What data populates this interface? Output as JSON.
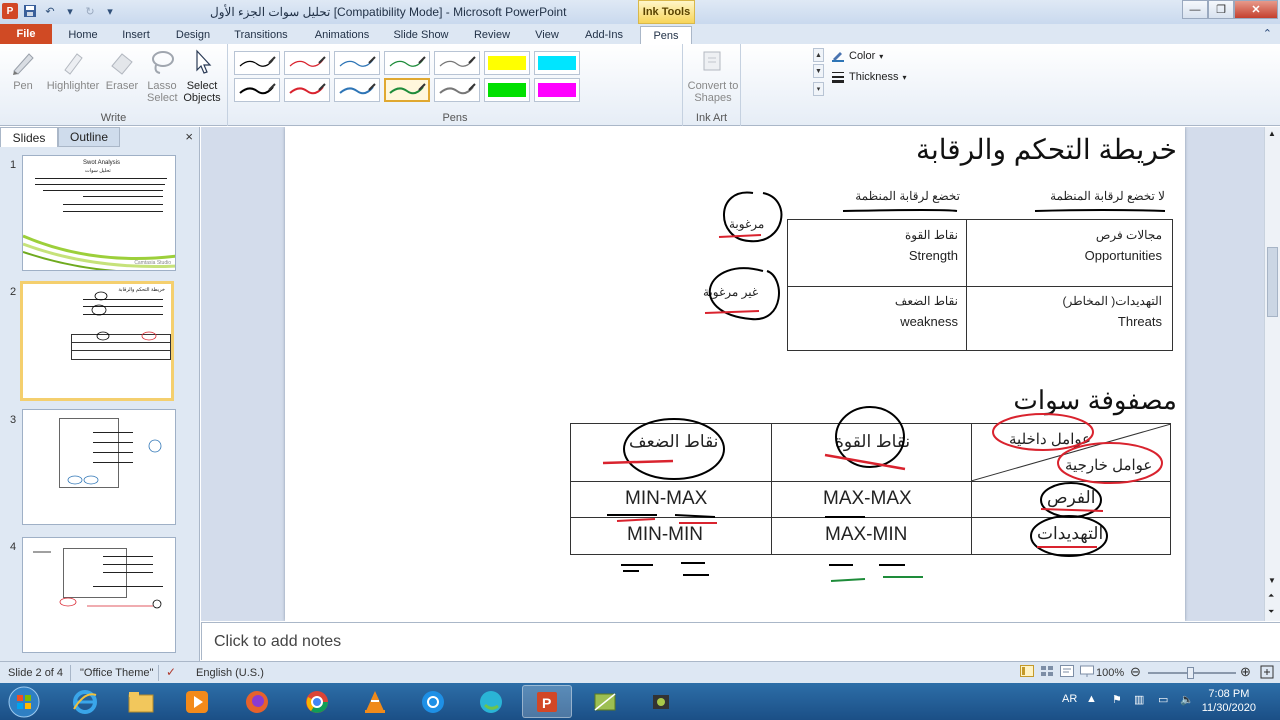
{
  "window": {
    "title": "تحليل سوات الجزء الأول [Compatibility Mode]  -  Microsoft PowerPoint",
    "context_tab_group": "Ink Tools",
    "app_letter": "P"
  },
  "ribbon_tabs": [
    "File",
    "Home",
    "Insert",
    "Design",
    "Transitions",
    "Animations",
    "Slide Show",
    "Review",
    "View",
    "Add-Ins",
    "Pens"
  ],
  "ribbon": {
    "write": {
      "label": "Write",
      "tools": [
        {
          "label": "Pen",
          "icon": "pen-icon"
        },
        {
          "label": "Highlighter",
          "icon": "highlighter-icon"
        },
        {
          "label": "Eraser",
          "icon": "eraser-icon"
        },
        {
          "label": "Lasso Select",
          "icon": "lasso-icon"
        },
        {
          "label": "Select Objects",
          "icon": "pointer-icon"
        }
      ]
    },
    "pens": {
      "label": "Pens",
      "swatches": [
        "#000000",
        "#d9232e",
        "#2e75b6",
        "#1e8c3a",
        "#777777",
        "#ffff00",
        "#00e5ff",
        "#000000",
        "#d9232e",
        "#2e75b6",
        "#1e8c3a",
        "#777777",
        "#00e000",
        "#ff00ff"
      ],
      "color_label": "Color",
      "thickness_label": "Thickness"
    },
    "ink_art": {
      "label": "Ink Art",
      "convert_label": "Convert to Shapes"
    }
  },
  "left_pane": {
    "tabs": [
      "Slides",
      "Outline"
    ],
    "close": "×",
    "thumbs": [
      {
        "num": "1",
        "title": "Swot Analysis",
        "sub": "تحليل سوات",
        "brand": "Camtasia Studio"
      },
      {
        "num": "2",
        "title": "خريطة التحكم والرقابة"
      },
      {
        "num": "3"
      },
      {
        "num": "4"
      }
    ]
  },
  "slide": {
    "title": "خريطة التحكم والرقابة",
    "col_head_right": "لا تخضع لرقابة المنظمة",
    "col_head_left": "تخضع لرقابة المنظمة",
    "cells": {
      "opp_ar": "مجالات فرص",
      "opp_en": "Opportunities",
      "str_ar": "نقاط القوة",
      "str_en": "Strength",
      "thr_ar": "التهديدات( المخاطر)",
      "thr_en": "Threats",
      "weak_ar": "نقاط الضعف",
      "weak_en": "weakness"
    },
    "desirable": "مرغوبة",
    "undesirable": "غير مرغوبة",
    "matrix_title": "مصفوفة سوات",
    "matrix": {
      "internal": "عوامل داخلية",
      "external": "عوامل خارجية",
      "strengths": "نقاط القوة",
      "weaknesses": "نقاط الضعف",
      "opportunities": "الفرص",
      "threats": "التهديدات",
      "maxmax": "MAX-MAX",
      "minmax": "MIN-MAX",
      "maxmin": "MAX-MIN",
      "minmin": "MIN-MIN"
    }
  },
  "notes_placeholder": "Click to add notes",
  "status": {
    "slide": "Slide 2 of 4",
    "theme": "\"Office Theme\"",
    "language": "English (U.S.)",
    "zoom": "100%"
  },
  "taskbar": {
    "lang": "AR",
    "time": "7:08 PM",
    "date": "11/30/2020"
  }
}
